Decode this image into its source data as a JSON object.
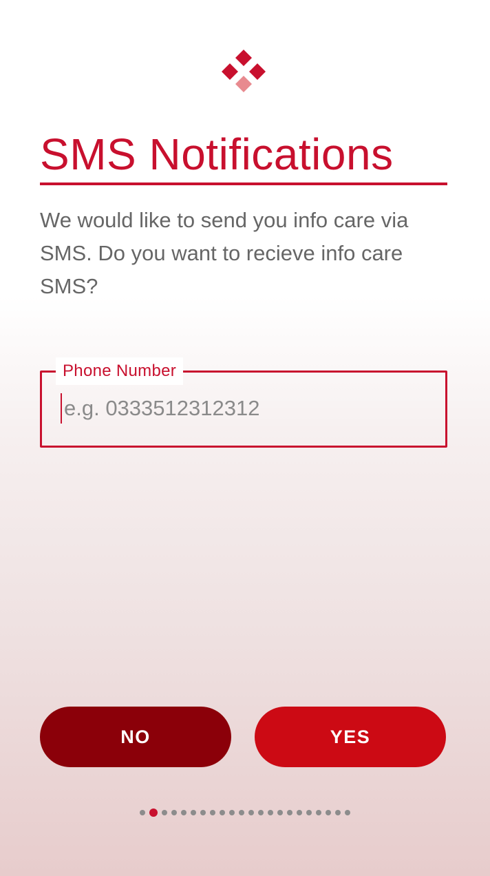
{
  "logo": {
    "icon": "diamond-cluster-logo",
    "colors": {
      "primary": "#c8102e",
      "light": "#e88a8f"
    }
  },
  "title": "SMS Notifications",
  "description": "We would like to send you info care via SMS. Do you want to recieve info care SMS?",
  "phone_field": {
    "label": "Phone Number",
    "value": "",
    "placeholder": "e.g. 0333512312312"
  },
  "buttons": {
    "no_label": "NO",
    "yes_label": "YES"
  },
  "pager": {
    "total": 22,
    "active_index": 1
  },
  "colors": {
    "accent": "#c8102e",
    "no_button": "#8b0009",
    "yes_button": "#cc0a14"
  }
}
